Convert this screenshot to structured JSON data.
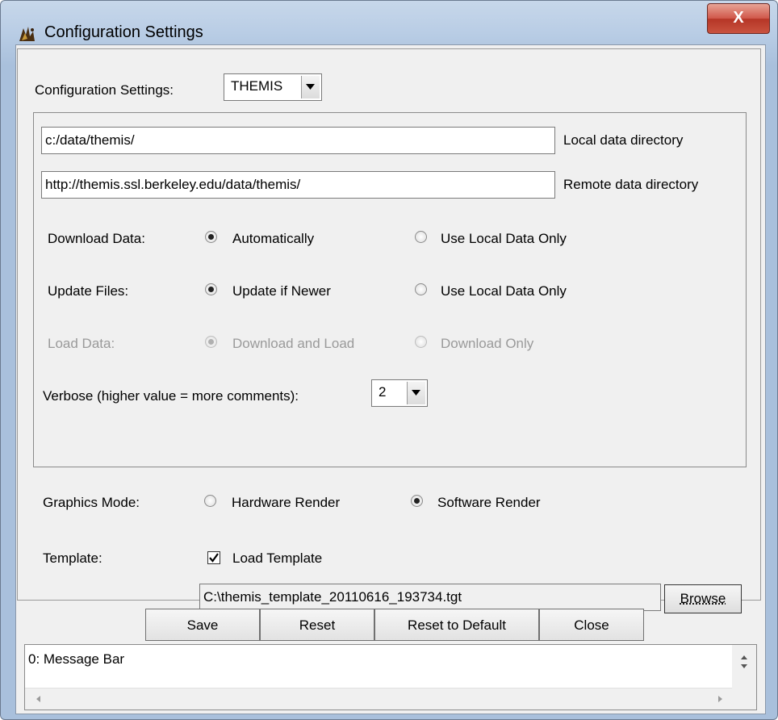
{
  "window": {
    "title": "Configuration Settings",
    "close_label": "X"
  },
  "settings": {
    "label": "Configuration Settings:",
    "selected": "THEMIS"
  },
  "paths": {
    "local_value": "c:/data/themis/",
    "local_label": "Local data directory",
    "remote_value": "http://themis.ssl.berkeley.edu/data/themis/",
    "remote_label": "Remote data directory"
  },
  "download": {
    "label": "Download Data:",
    "opt1": "Automatically",
    "opt2": "Use Local Data Only",
    "selected": "opt1"
  },
  "update": {
    "label": "Update Files:",
    "opt1": "Update if Newer",
    "opt2": "Use Local Data Only",
    "selected": "opt1"
  },
  "load": {
    "label": "Load Data:",
    "opt1": "Download and Load",
    "opt2": "Download Only",
    "selected": "opt1",
    "disabled": true
  },
  "verbose": {
    "label": "Verbose (higher value = more comments):",
    "value": "2"
  },
  "graphics": {
    "label": "Graphics Mode:",
    "opt1": "Hardware Render",
    "opt2": "Software Render",
    "selected": "opt2"
  },
  "template": {
    "label": "Template:",
    "checkbox_label": "Load Template",
    "checked": true,
    "path": "C:\\themis_template_20110616_193734.tgt",
    "browse_label": "Browse"
  },
  "buttons": {
    "save": "Save",
    "reset": "Reset",
    "reset_default": "Reset to Default",
    "close": "Close"
  },
  "message_bar": {
    "text": "0: Message Bar"
  }
}
